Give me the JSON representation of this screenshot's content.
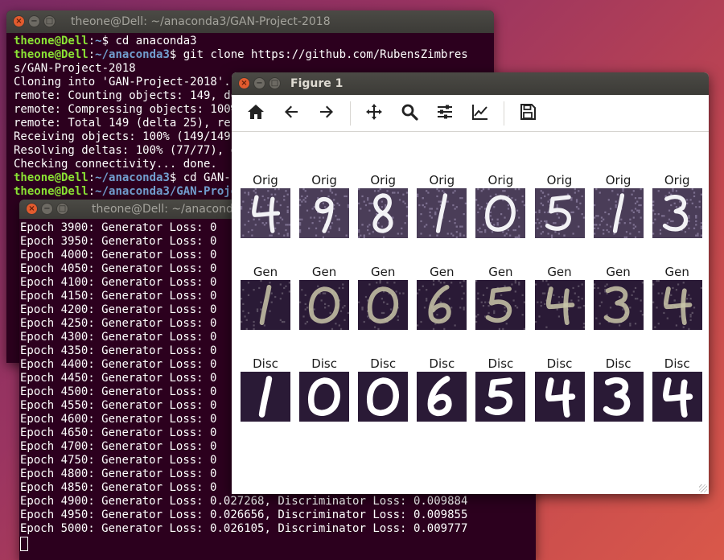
{
  "back_terminal": {
    "title": "theone@Dell: ~/anaconda3/GAN-Project-2018",
    "lines": [
      [
        {
          "t": "theone@Dell",
          "c": "u"
        },
        {
          "t": ":"
        },
        {
          "t": "~",
          "c": "p"
        },
        {
          "t": "$ cd anaconda3"
        }
      ],
      [
        {
          "t": "theone@Dell",
          "c": "u"
        },
        {
          "t": ":"
        },
        {
          "t": "~/anaconda3",
          "c": "p"
        },
        {
          "t": "$ git clone https://github.com/RubensZimbres"
        }
      ],
      [
        {
          "t": "s/GAN-Project-2018"
        }
      ],
      [
        {
          "t": "Cloning into 'GAN-Project-2018'..."
        }
      ],
      [
        {
          "t": "remote: Counting objects: 149, done."
        }
      ],
      [
        {
          "t": "remote: Compressing objects: 100% (94/94), done."
        }
      ],
      [
        {
          "t": "remote: Total 149 (delta 25), reused 0 (delta 0)"
        }
      ],
      [
        {
          "t": "Receiving objects: 100% (149/149), done."
        }
      ],
      [
        {
          "t": "Resolving deltas: 100% (77/77), done."
        }
      ],
      [
        {
          "t": "Checking connectivity... done."
        }
      ],
      [
        {
          "t": "theone@Dell",
          "c": "u"
        },
        {
          "t": ":"
        },
        {
          "t": "~/anaconda3",
          "c": "p"
        },
        {
          "t": "$ cd GAN-Project-2018"
        }
      ],
      [
        {
          "t": "theone@Dell",
          "c": "u"
        },
        {
          "t": ":"
        },
        {
          "t": "~/anaconda3/GAN-Project-2018",
          "c": "p"
        },
        {
          "t": "$ "
        }
      ]
    ]
  },
  "front_terminal": {
    "title": "theone@Dell: ~/anaconda3",
    "label_epoch": "Epoch",
    "label_gen": "Generator Loss:",
    "label_disc": "Discriminator Loss:",
    "epochs": [
      {
        "n": "3900",
        "g": "0",
        "d": ""
      },
      {
        "n": "3950",
        "g": "0",
        "d": ""
      },
      {
        "n": "4000",
        "g": "0",
        "d": ""
      },
      {
        "n": "4050",
        "g": "0",
        "d": ""
      },
      {
        "n": "4100",
        "g": "0",
        "d": ""
      },
      {
        "n": "4150",
        "g": "0",
        "d": ""
      },
      {
        "n": "4200",
        "g": "0",
        "d": ""
      },
      {
        "n": "4250",
        "g": "0",
        "d": ""
      },
      {
        "n": "4300",
        "g": "0",
        "d": ""
      },
      {
        "n": "4350",
        "g": "0",
        "d": ""
      },
      {
        "n": "4400",
        "g": "0",
        "d": ""
      },
      {
        "n": "4450",
        "g": "0",
        "d": ""
      },
      {
        "n": "4500",
        "g": "0",
        "d": ""
      },
      {
        "n": "4550",
        "g": "0",
        "d": ""
      },
      {
        "n": "4600",
        "g": "0",
        "d": ""
      },
      {
        "n": "4650",
        "g": "0",
        "d": ""
      },
      {
        "n": "4700",
        "g": "0",
        "d": ""
      },
      {
        "n": "4750",
        "g": "0",
        "d": ""
      },
      {
        "n": "4800",
        "g": "0",
        "d": ""
      },
      {
        "n": "4850",
        "g": "0",
        "d": ""
      },
      {
        "n": "4900",
        "g": "0.027268",
        "d": "0.009884"
      },
      {
        "n": "4950",
        "g": "0.026656",
        "d": "0.009855"
      },
      {
        "n": "5000",
        "g": "0.026105",
        "d": "0.009777"
      }
    ]
  },
  "figure": {
    "title": "Figure 1",
    "toolbar": [
      {
        "icon": "home-icon"
      },
      {
        "icon": "back-icon"
      },
      {
        "icon": "forward-icon"
      },
      {
        "sep": true
      },
      {
        "icon": "pan-icon"
      },
      {
        "icon": "zoom-icon"
      },
      {
        "icon": "subplots-icon"
      },
      {
        "icon": "axes-icon"
      },
      {
        "sep": true
      },
      {
        "icon": "save-icon"
      }
    ],
    "rows": [
      {
        "label": "Orig",
        "digits": [
          "4",
          "9",
          "8",
          "1",
          "0",
          "5",
          "1",
          "3"
        ]
      },
      {
        "label": "Gen",
        "digits": [
          "1",
          "0",
          "0",
          "6",
          "5",
          "4",
          "3",
          "4"
        ]
      },
      {
        "label": "Disc",
        "digits": [
          "1",
          "0",
          "0",
          "6",
          "5",
          "4",
          "3",
          "4"
        ]
      }
    ]
  },
  "colors": {
    "terminal_bg": "#2c001e",
    "user_green": "#8ae234",
    "path_blue": "#729fcf",
    "digit_bg": "#2a1a36"
  }
}
